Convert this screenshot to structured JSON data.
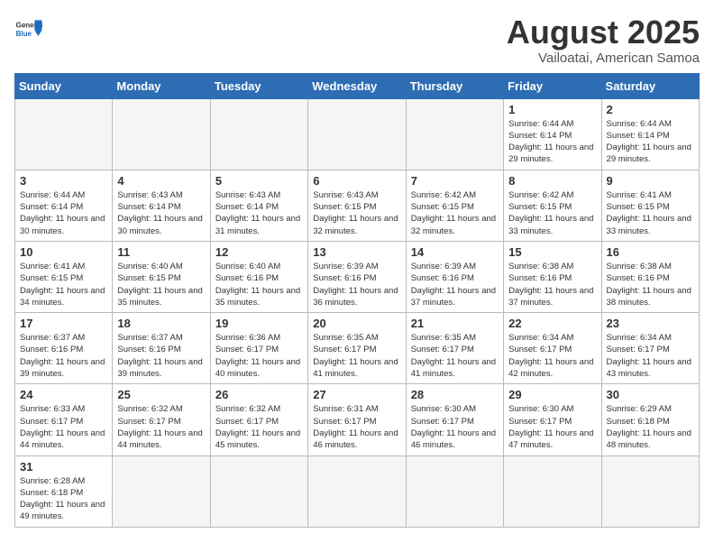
{
  "header": {
    "logo_general": "General",
    "logo_blue": "Blue",
    "month": "August 2025",
    "location": "Vailoatai, American Samoa"
  },
  "days_of_week": [
    "Sunday",
    "Monday",
    "Tuesday",
    "Wednesday",
    "Thursday",
    "Friday",
    "Saturday"
  ],
  "weeks": [
    [
      {
        "day": "",
        "info": ""
      },
      {
        "day": "",
        "info": ""
      },
      {
        "day": "",
        "info": ""
      },
      {
        "day": "",
        "info": ""
      },
      {
        "day": "",
        "info": ""
      },
      {
        "day": "1",
        "info": "Sunrise: 6:44 AM\nSunset: 6:14 PM\nDaylight: 11 hours\nand 29 minutes."
      },
      {
        "day": "2",
        "info": "Sunrise: 6:44 AM\nSunset: 6:14 PM\nDaylight: 11 hours\nand 29 minutes."
      }
    ],
    [
      {
        "day": "3",
        "info": "Sunrise: 6:44 AM\nSunset: 6:14 PM\nDaylight: 11 hours\nand 30 minutes."
      },
      {
        "day": "4",
        "info": "Sunrise: 6:43 AM\nSunset: 6:14 PM\nDaylight: 11 hours\nand 30 minutes."
      },
      {
        "day": "5",
        "info": "Sunrise: 6:43 AM\nSunset: 6:14 PM\nDaylight: 11 hours\nand 31 minutes."
      },
      {
        "day": "6",
        "info": "Sunrise: 6:43 AM\nSunset: 6:15 PM\nDaylight: 11 hours\nand 32 minutes."
      },
      {
        "day": "7",
        "info": "Sunrise: 6:42 AM\nSunset: 6:15 PM\nDaylight: 11 hours\nand 32 minutes."
      },
      {
        "day": "8",
        "info": "Sunrise: 6:42 AM\nSunset: 6:15 PM\nDaylight: 11 hours\nand 33 minutes."
      },
      {
        "day": "9",
        "info": "Sunrise: 6:41 AM\nSunset: 6:15 PM\nDaylight: 11 hours\nand 33 minutes."
      }
    ],
    [
      {
        "day": "10",
        "info": "Sunrise: 6:41 AM\nSunset: 6:15 PM\nDaylight: 11 hours\nand 34 minutes."
      },
      {
        "day": "11",
        "info": "Sunrise: 6:40 AM\nSunset: 6:15 PM\nDaylight: 11 hours\nand 35 minutes."
      },
      {
        "day": "12",
        "info": "Sunrise: 6:40 AM\nSunset: 6:16 PM\nDaylight: 11 hours\nand 35 minutes."
      },
      {
        "day": "13",
        "info": "Sunrise: 6:39 AM\nSunset: 6:16 PM\nDaylight: 11 hours\nand 36 minutes."
      },
      {
        "day": "14",
        "info": "Sunrise: 6:39 AM\nSunset: 6:16 PM\nDaylight: 11 hours\nand 37 minutes."
      },
      {
        "day": "15",
        "info": "Sunrise: 6:38 AM\nSunset: 6:16 PM\nDaylight: 11 hours\nand 37 minutes."
      },
      {
        "day": "16",
        "info": "Sunrise: 6:38 AM\nSunset: 6:16 PM\nDaylight: 11 hours\nand 38 minutes."
      }
    ],
    [
      {
        "day": "17",
        "info": "Sunrise: 6:37 AM\nSunset: 6:16 PM\nDaylight: 11 hours\nand 39 minutes."
      },
      {
        "day": "18",
        "info": "Sunrise: 6:37 AM\nSunset: 6:16 PM\nDaylight: 11 hours\nand 39 minutes."
      },
      {
        "day": "19",
        "info": "Sunrise: 6:36 AM\nSunset: 6:17 PM\nDaylight: 11 hours\nand 40 minutes."
      },
      {
        "day": "20",
        "info": "Sunrise: 6:35 AM\nSunset: 6:17 PM\nDaylight: 11 hours\nand 41 minutes."
      },
      {
        "day": "21",
        "info": "Sunrise: 6:35 AM\nSunset: 6:17 PM\nDaylight: 11 hours\nand 41 minutes."
      },
      {
        "day": "22",
        "info": "Sunrise: 6:34 AM\nSunset: 6:17 PM\nDaylight: 11 hours\nand 42 minutes."
      },
      {
        "day": "23",
        "info": "Sunrise: 6:34 AM\nSunset: 6:17 PM\nDaylight: 11 hours\nand 43 minutes."
      }
    ],
    [
      {
        "day": "24",
        "info": "Sunrise: 6:33 AM\nSunset: 6:17 PM\nDaylight: 11 hours\nand 44 minutes."
      },
      {
        "day": "25",
        "info": "Sunrise: 6:32 AM\nSunset: 6:17 PM\nDaylight: 11 hours\nand 44 minutes."
      },
      {
        "day": "26",
        "info": "Sunrise: 6:32 AM\nSunset: 6:17 PM\nDaylight: 11 hours\nand 45 minutes."
      },
      {
        "day": "27",
        "info": "Sunrise: 6:31 AM\nSunset: 6:17 PM\nDaylight: 11 hours\nand 46 minutes."
      },
      {
        "day": "28",
        "info": "Sunrise: 6:30 AM\nSunset: 6:17 PM\nDaylight: 11 hours\nand 46 minutes."
      },
      {
        "day": "29",
        "info": "Sunrise: 6:30 AM\nSunset: 6:17 PM\nDaylight: 11 hours\nand 47 minutes."
      },
      {
        "day": "30",
        "info": "Sunrise: 6:29 AM\nSunset: 6:18 PM\nDaylight: 11 hours\nand 48 minutes."
      }
    ],
    [
      {
        "day": "31",
        "info": "Sunrise: 6:28 AM\nSunset: 6:18 PM\nDaylight: 11 hours\nand 49 minutes."
      },
      {
        "day": "",
        "info": ""
      },
      {
        "day": "",
        "info": ""
      },
      {
        "day": "",
        "info": ""
      },
      {
        "day": "",
        "info": ""
      },
      {
        "day": "",
        "info": ""
      },
      {
        "day": "",
        "info": ""
      }
    ]
  ]
}
